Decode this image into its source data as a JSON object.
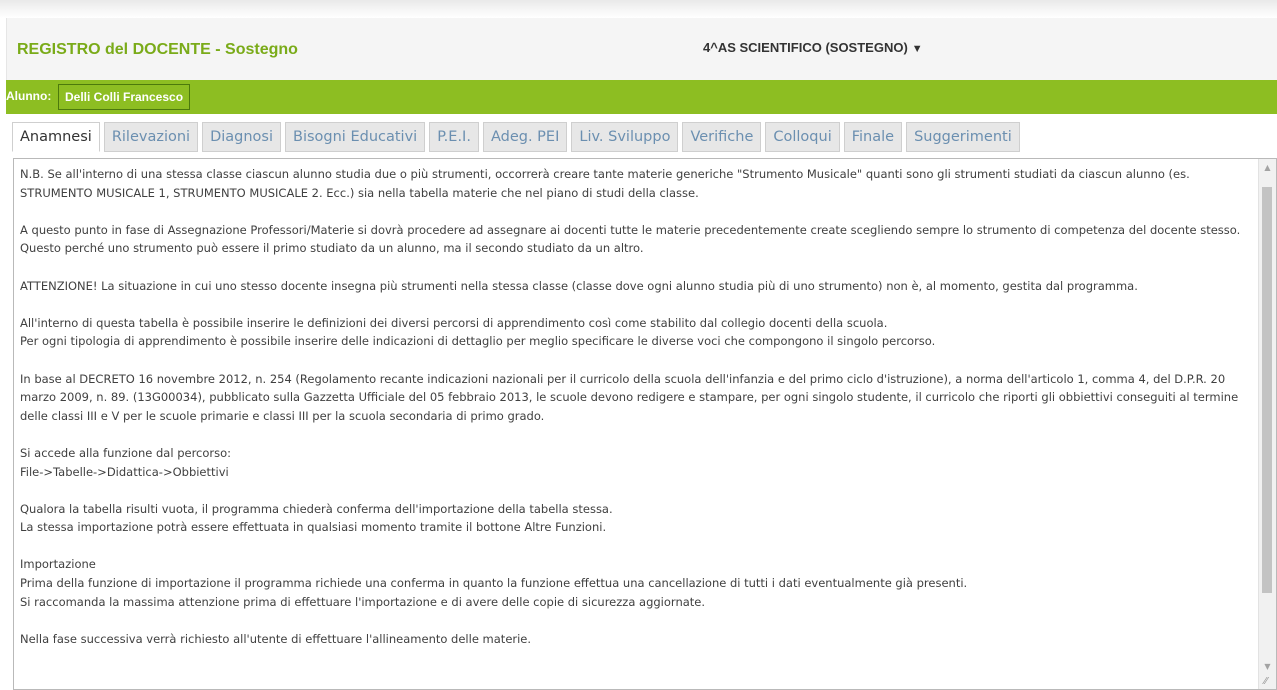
{
  "header": {
    "title": "REGISTRO del DOCENTE - Sostegno",
    "class_selector": "4^AS SCIENTIFICO (SOSTEGNO)",
    "caret": "▼"
  },
  "student": {
    "label": "Alunno:",
    "name": "Delli Colli Francesco"
  },
  "tabs": [
    {
      "label": "Anamnesi",
      "active": true
    },
    {
      "label": "Rilevazioni"
    },
    {
      "label": "Diagnosi"
    },
    {
      "label": "Bisogni Educativi"
    },
    {
      "label": "P.E.I."
    },
    {
      "label": "Adeg. PEI"
    },
    {
      "label": "Liv. Sviluppo"
    },
    {
      "label": "Verifiche"
    },
    {
      "label": "Colloqui"
    },
    {
      "label": "Finale"
    },
    {
      "label": "Suggerimenti"
    }
  ],
  "content": {
    "paragraphs": [
      "N.B. Se all'interno di una stessa classe ciascun alunno studia due o più strumenti, occorrerà creare tante materie generiche \"Strumento Musicale\" quanti sono gli strumenti studiati da ciascun alunno (es. STRUMENTO MUSICALE 1, STRUMENTO MUSICALE 2. Ecc.) sia nella tabella materie che nel piano di studi della classe.",
      "A questo punto in fase di Assegnazione Professori/Materie si dovrà procedere ad assegnare ai docenti tutte le materie precedentemente create scegliendo sempre lo strumento di competenza del docente stesso. Questo perché uno strumento può essere il primo studiato da un alunno, ma il secondo studiato da un altro.",
      "ATTENZIONE! La situazione in cui uno stesso docente insegna più strumenti nella stessa classe (classe dove ogni alunno studia più di uno strumento) non è, al momento, gestita dal programma.",
      "All'interno di questa tabella è possibile inserire le definizioni dei diversi percorsi di apprendimento così come stabilito dal collegio docenti della scuola.\nPer ogni tipologia di apprendimento è possibile inserire delle indicazioni di dettaglio per meglio specificare le diverse voci che compongono il singolo percorso.",
      "In base al DECRETO 16 novembre 2012, n. 254 (Regolamento recante indicazioni nazionali per il curricolo della scuola dell'infanzia e del primo ciclo d'istruzione), a norma dell'articolo 1, comma 4, del D.P.R. 20 marzo 2009, n. 89. (13G00034), pubblicato sulla Gazzetta Ufficiale del 05 febbraio 2013, le scuole devono redigere e stampare, per ogni singolo studente,  il curricolo che riporti gli obbiettivi conseguiti al termine delle classi III  e V  per le scuole primarie e classi III per la scuola secondaria di primo grado.",
      "Si accede alla funzione dal percorso:\nFile->Tabelle->Didattica->Obbiettivi",
      "Qualora la tabella risulti vuota, il programma chiederà conferma dell'importazione della tabella stessa.\nLa stessa importazione potrà essere effettuata in qualsiasi momento tramite il bottone Altre Funzioni.",
      "Importazione\nPrima della funzione di importazione il programma richiede una conferma in quanto la funzione effettua una cancellazione di tutti i dati eventualmente già presenti.\nSi raccomanda la massima attenzione prima di effettuare l'importazione e di avere delle copie di sicurezza aggiornate.",
      "Nella fase successiva verrà richiesto all'utente di effettuare l'allineamento delle materie."
    ]
  },
  "scrollbar": {
    "up_arrow": "▲",
    "down_arrow": "▼",
    "grip": "⁄⁄"
  },
  "colors": {
    "title_green": "#7aab19",
    "student_bar_green": "#8dbe22",
    "tab_text": "#6b8fb0"
  }
}
